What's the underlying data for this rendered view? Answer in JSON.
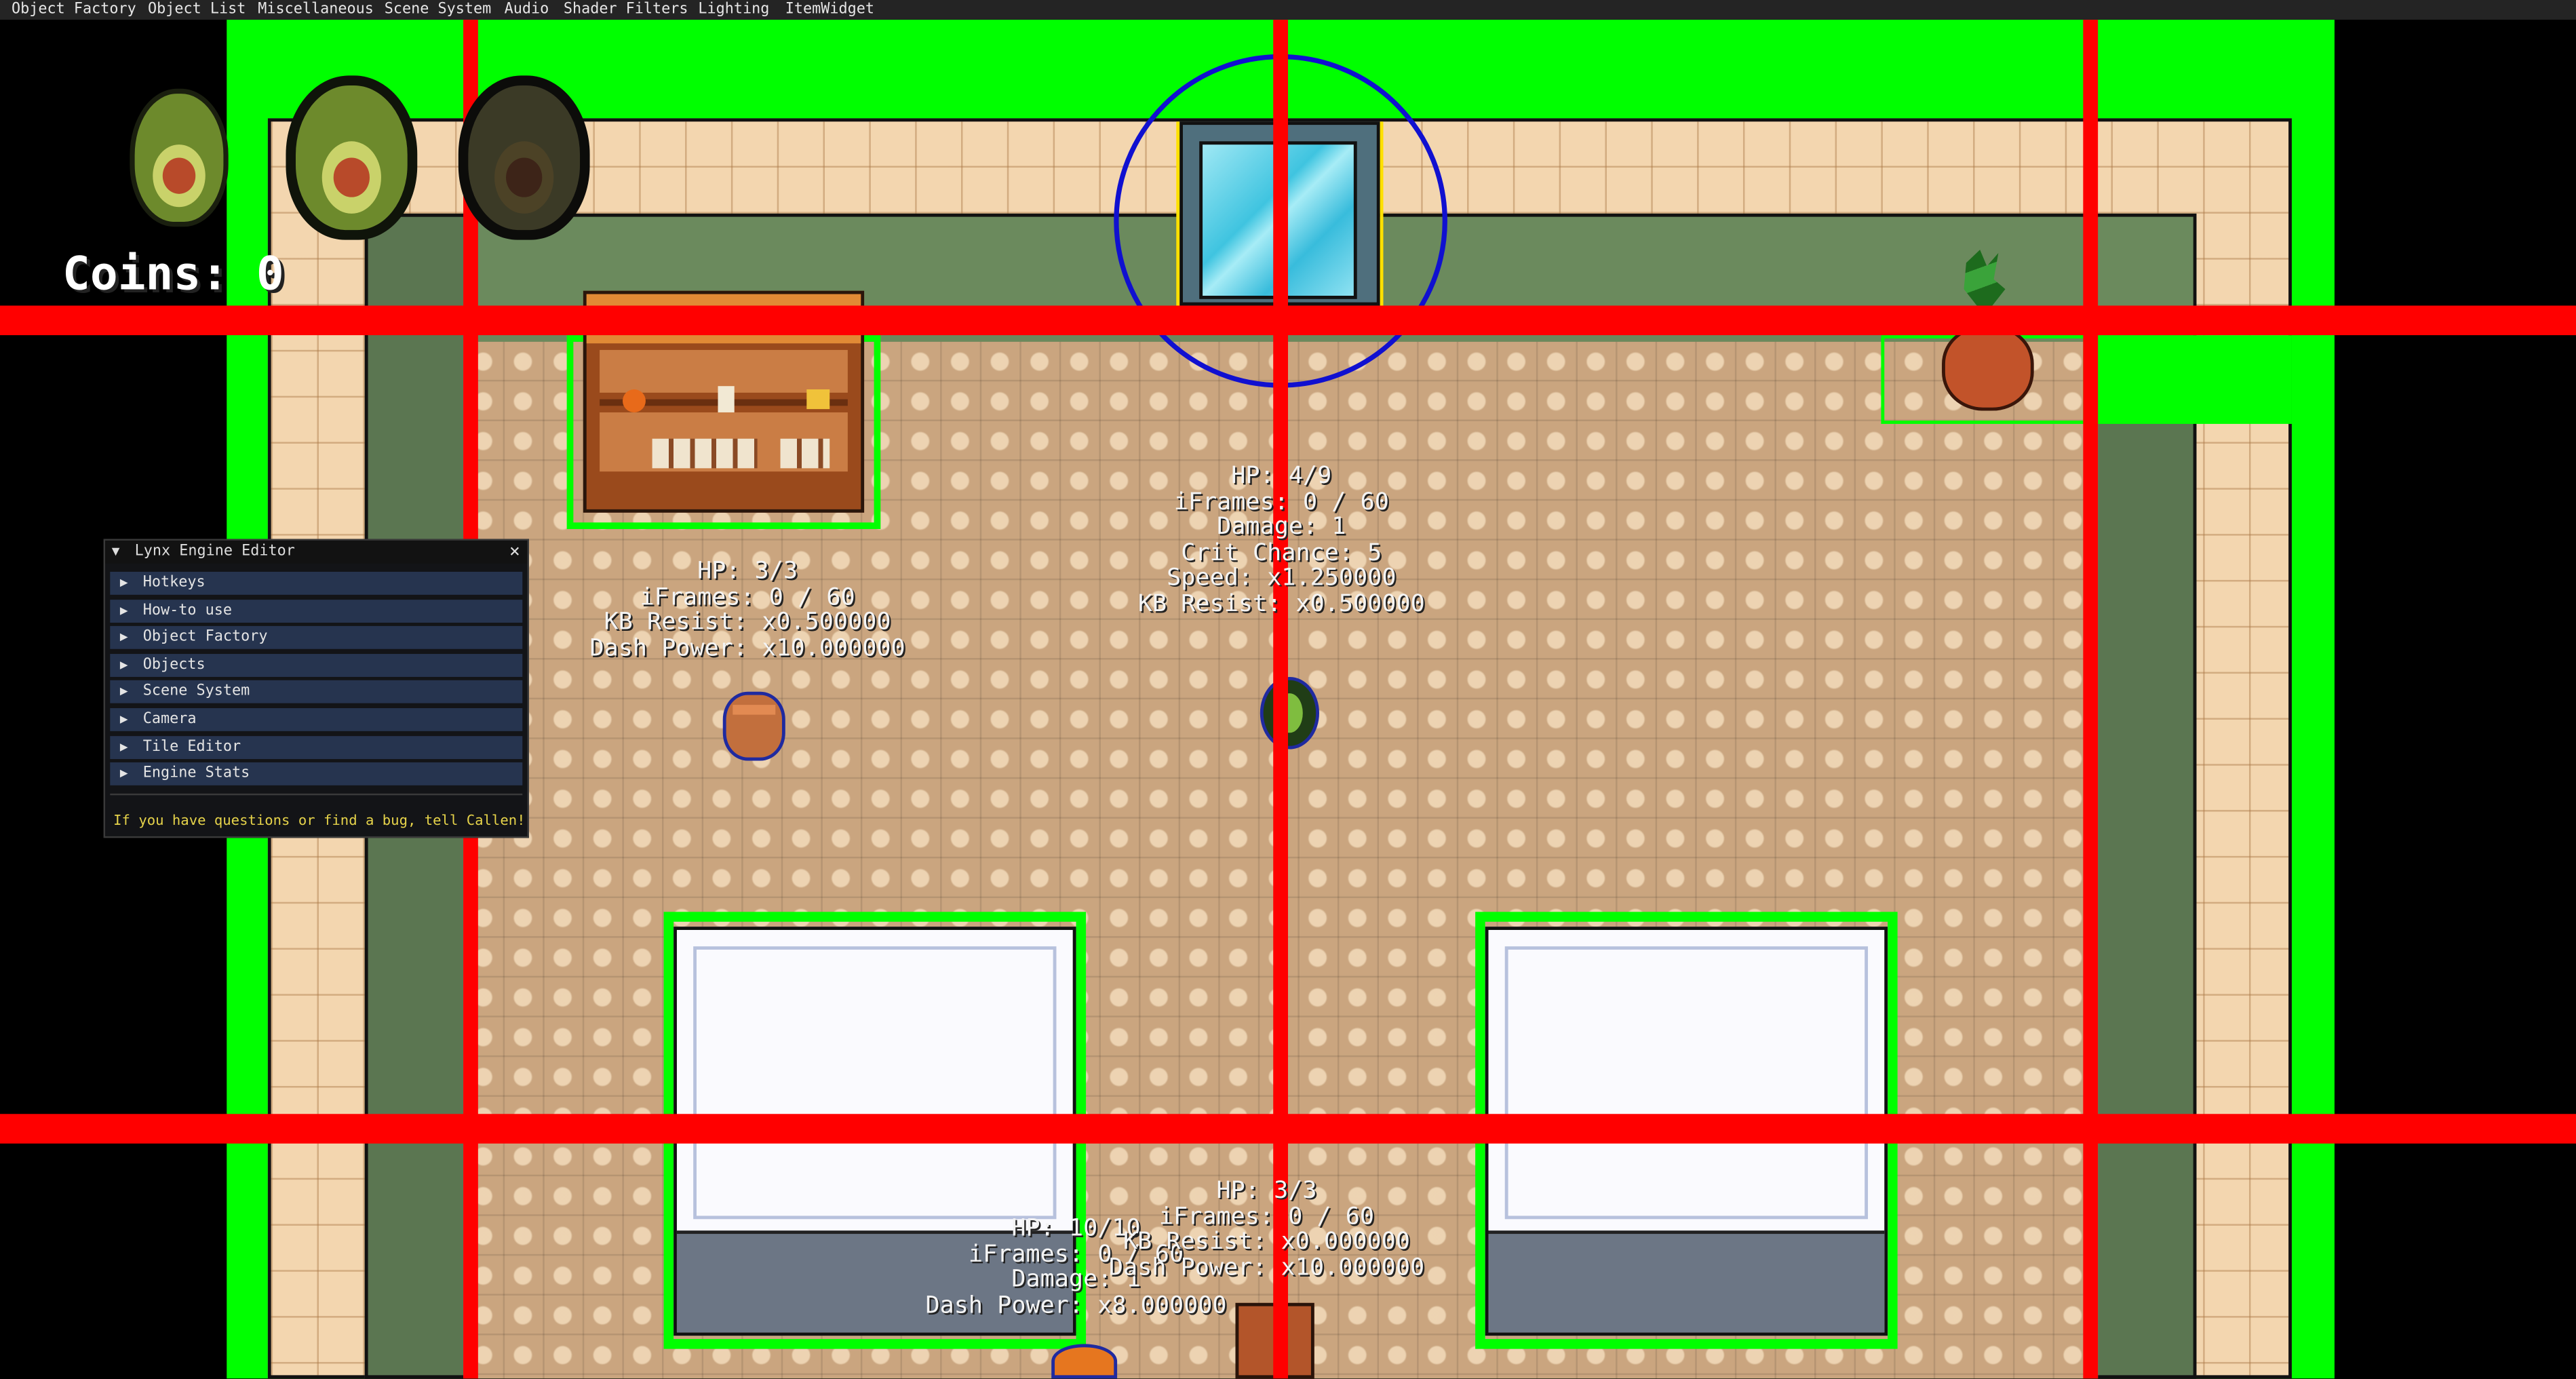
{
  "menu": {
    "items": [
      "Object Factory",
      "Object List",
      "Miscellaneous",
      "Scene System",
      "Audio",
      "Shader Filters",
      "Lighting",
      "ItemWidget"
    ]
  },
  "hud": {
    "coins_label": "Coins: 0",
    "health_slots": [
      {
        "state": "full"
      },
      {
        "state": "full"
      },
      {
        "state": "empty"
      }
    ]
  },
  "editor_panel": {
    "title": "Lynx Engine Editor",
    "close_glyph": "×",
    "collapse_glyph": "▼",
    "item_glyph": "▶",
    "items": [
      "Hotkeys",
      "How-to use",
      "Object Factory",
      "Objects",
      "Scene System",
      "Camera",
      "Tile Editor",
      "Engine Stats"
    ],
    "note": "If you have questions or find a bug, tell Callen!"
  },
  "entities": {
    "player_stats": [
      "HP: 4/9",
      "iFrames: 0 / 60",
      "Damage: 1",
      "Crit Chance: 5",
      "Speed: x1.250000",
      "KB Resist: x0.500000"
    ],
    "barrel_stats": [
      "HP: 3/3",
      "iFrames: 0 / 60",
      "KB Resist: x0.500000",
      "Dash Power: x10.000000"
    ],
    "bottom_right_stats": [
      "HP: 3/3",
      "iFrames: 0 / 60",
      "KB Resist: x0.000000",
      "Dash Power: x10.000000"
    ],
    "bottom_left_stats": [
      "HP: 10/10",
      "iFrames: 0 / 60",
      "Damage: 1",
      "Dash Power: x8.000000"
    ]
  },
  "colors": {
    "collider_green": "#00ff00",
    "grid_red": "#ff0000",
    "camera_blue": "#1010d0",
    "menubar": "#242424",
    "panel_item": "#26344f",
    "note_yellow": "#e6d34a"
  }
}
